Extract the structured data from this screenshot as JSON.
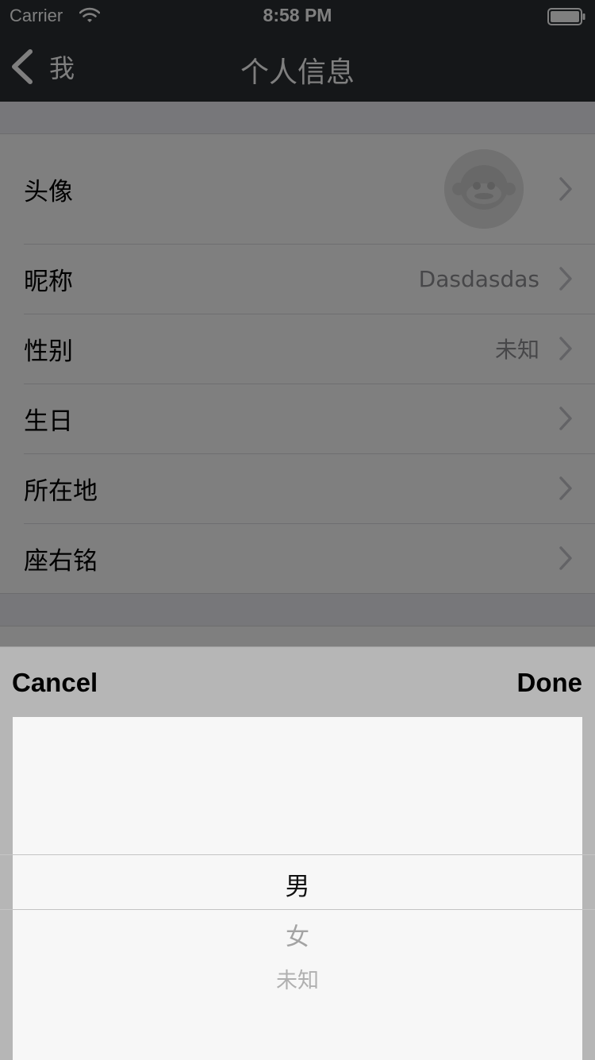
{
  "status_bar": {
    "carrier": "Carrier",
    "time": "8:58 PM",
    "wifi_icon": "wifi-icon",
    "battery_icon": "battery-full-icon"
  },
  "nav": {
    "back_label": "我",
    "back_icon": "chevron-left-icon",
    "title": "个人信息"
  },
  "profile_rows": [
    {
      "label": "头像",
      "value": "",
      "icon": "monkey-avatar"
    },
    {
      "label": "昵称",
      "value": "Dasdasdas"
    },
    {
      "label": "性别",
      "value": "未知"
    },
    {
      "label": "生日",
      "value": ""
    },
    {
      "label": "所在地",
      "value": ""
    },
    {
      "label": "座右铭",
      "value": ""
    }
  ],
  "picker": {
    "cancel_label": "Cancel",
    "done_label": "Done",
    "options": [
      "男",
      "女",
      "未知"
    ],
    "selected": "男"
  },
  "colors": {
    "nav_background": "#2a2e33",
    "overlay": "rgba(0,0,0,0.5)",
    "picker_toolbar": "#b6b6b6",
    "picker_wheel": "#f7f7f7"
  }
}
